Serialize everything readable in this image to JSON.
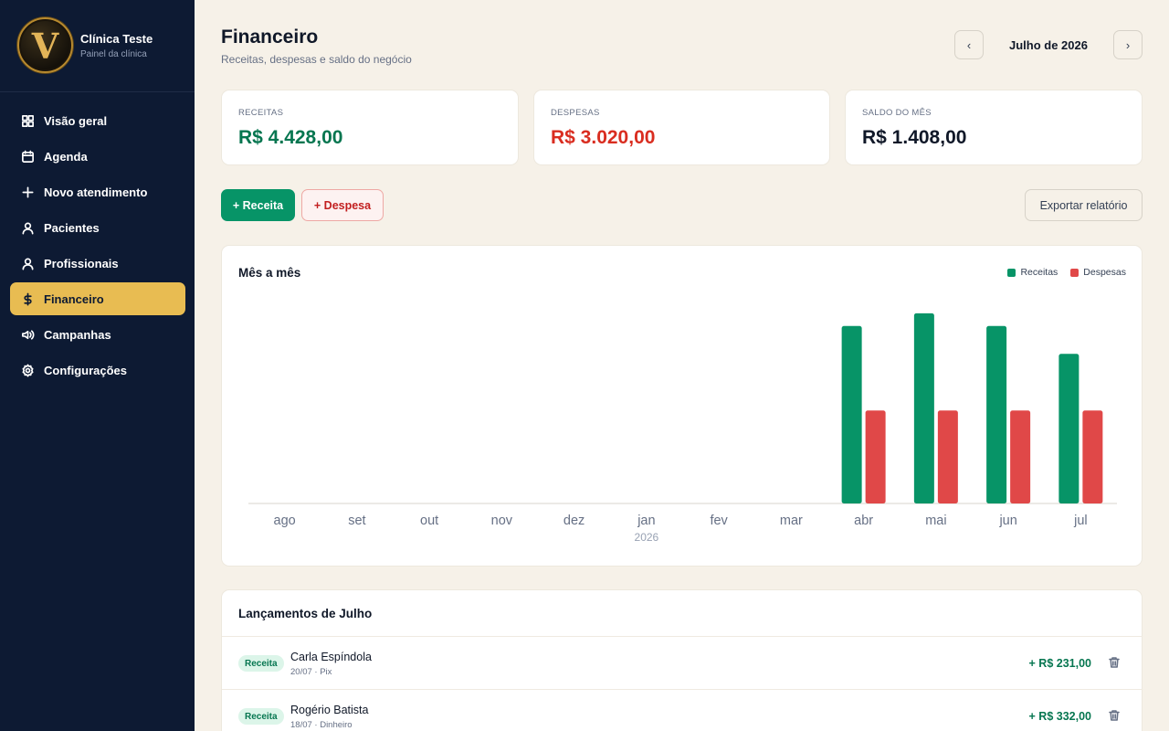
{
  "brand": {
    "logo_letter": "V",
    "name": "Clínica Teste",
    "subtitle": "Painel da clínica"
  },
  "nav": [
    {
      "label": "Visão geral",
      "icon": "grid-icon",
      "active": false
    },
    {
      "label": "Agenda",
      "icon": "calendar-icon",
      "active": false
    },
    {
      "label": "Novo atendimento",
      "icon": "plus-icon",
      "active": false
    },
    {
      "label": "Pacientes",
      "icon": "user-icon",
      "active": false
    },
    {
      "label": "Profissionais",
      "icon": "user-icon",
      "active": false
    },
    {
      "label": "Financeiro",
      "icon": "dollar-icon",
      "active": true
    },
    {
      "label": "Campanhas",
      "icon": "megaphone-icon",
      "active": false
    },
    {
      "label": "Configurações",
      "icon": "gear-icon",
      "active": false
    }
  ],
  "header": {
    "title": "Financeiro",
    "subtitle": "Receitas, despesas e saldo do negócio",
    "prev": "‹",
    "next": "›",
    "month": "Julho de 2026"
  },
  "stats": {
    "receitas": {
      "label": "RECEITAS",
      "value": "R$ 4.428,00",
      "color": "#067650"
    },
    "despesas": {
      "label": "DESPESAS",
      "value": "R$ 3.020,00",
      "color": "#d92d20"
    },
    "saldo": {
      "label": "SALDO DO MÊS",
      "value": "R$ 1.408,00",
      "color": "#101828"
    }
  },
  "actions": {
    "receita": "+ Receita",
    "despesa": "+ Despesa",
    "export": "Exportar relatório"
  },
  "chart": {
    "title": "Mês a mês",
    "legend": {
      "receitas": "Receitas",
      "despesas": "Despesas"
    },
    "colors": {
      "receitas": "#079467",
      "despesas": "#e04848"
    }
  },
  "chart_data": {
    "type": "bar",
    "categories": [
      "ago",
      "set",
      "out",
      "nov",
      "dez",
      "jan",
      "fev",
      "mar",
      "abr",
      "mai",
      "jun",
      "jul"
    ],
    "year_marker": {
      "category": "jan",
      "label": "2026"
    },
    "series": [
      {
        "name": "Receitas",
        "values": [
          0,
          0,
          0,
          0,
          0,
          0,
          0,
          0,
          4200,
          4500,
          4200,
          3540
        ]
      },
      {
        "name": "Despesas",
        "values": [
          0,
          0,
          0,
          0,
          0,
          0,
          0,
          0,
          2200,
          2200,
          2200,
          2200
        ]
      }
    ],
    "ylim": [
      0,
      4800
    ],
    "grid": false,
    "legend_position": "top-right"
  },
  "transactions": {
    "title": "Lançamentos de Julho",
    "rows": [
      {
        "badge": "Receita",
        "name": "Carla Espíndola",
        "meta": "20/07 · Pix",
        "amount": "+ R$ 231,00"
      },
      {
        "badge": "Receita",
        "name": "Rogério Batista",
        "meta": "18/07 · Dinheiro",
        "amount": "+ R$ 332,00"
      }
    ]
  }
}
